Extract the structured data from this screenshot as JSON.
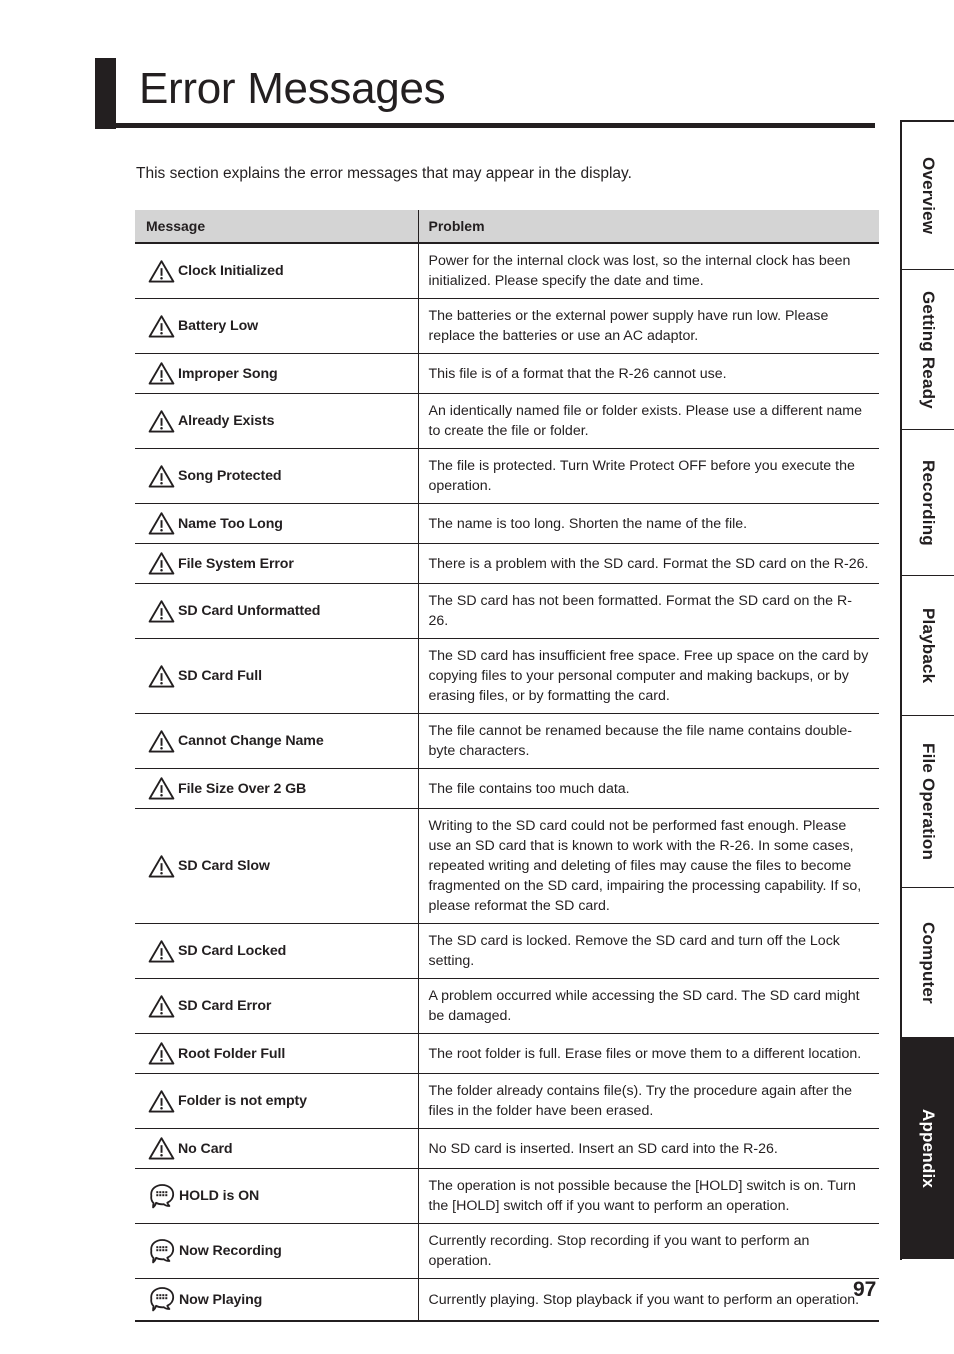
{
  "page": {
    "title": "Error Messages",
    "intro": "This section explains the error messages that may appear in the display.",
    "page_number": "97"
  },
  "table": {
    "headers": {
      "message": "Message",
      "problem": "Problem"
    },
    "rows": [
      {
        "icon": "warning-triangle-icon",
        "message": "Clock Initialized",
        "problem": "Power for the internal clock was lost, so the internal clock has been initialized. Please specify the date and time."
      },
      {
        "icon": "warning-triangle-icon",
        "message": "Battery Low",
        "problem": "The batteries or the external power supply have run low. Please replace the batteries or use an AC adaptor."
      },
      {
        "icon": "warning-triangle-icon",
        "message": "Improper Song",
        "problem": "This file is of a format that the R-26 cannot use."
      },
      {
        "icon": "warning-triangle-icon",
        "message": "Already Exists",
        "problem": "An identically named file or folder exists. Please use a different name to create the file or folder."
      },
      {
        "icon": "warning-triangle-icon",
        "message": "Song Protected",
        "problem": "The file is protected. Turn Write Protect OFF before you execute the operation."
      },
      {
        "icon": "warning-triangle-icon",
        "message": "Name Too Long",
        "problem": "The name is too long. Shorten the name of the file."
      },
      {
        "icon": "warning-triangle-icon",
        "message": "File System Error",
        "problem": "There is a problem with the SD card. Format the SD card on the R-26."
      },
      {
        "icon": "warning-triangle-icon",
        "message": "SD Card Unformatted",
        "problem": "The SD card has not been formatted. Format the SD card on the R-26."
      },
      {
        "icon": "warning-triangle-icon",
        "message": "SD Card Full",
        "problem": "The SD card has insufficient free space. Free up space on the card by copying files to your personal computer and making backups, or by erasing files, or by formatting the card."
      },
      {
        "icon": "warning-triangle-icon",
        "message": "Cannot Change Name",
        "problem": "The file cannot be renamed because the file name contains double-byte characters."
      },
      {
        "icon": "warning-triangle-icon",
        "message": "File Size Over 2 GB",
        "problem": "The file contains too much data."
      },
      {
        "icon": "warning-triangle-icon",
        "message": "SD Card Slow",
        "problem": "Writing to the SD card could not be performed fast enough. Please use an SD card that is known to work with the R-26. In some cases, repeated writing and deleting of files may cause the files to become fragmented on the SD card, impairing the processing capability. If so, please reformat the SD card."
      },
      {
        "icon": "warning-triangle-icon",
        "message": "SD Card Locked",
        "problem": "The SD card is locked. Remove the SD card and turn off the Lock setting."
      },
      {
        "icon": "warning-triangle-icon",
        "message": "SD Card Error",
        "problem": "A problem occurred while accessing the SD card. The SD card might be damaged."
      },
      {
        "icon": "warning-triangle-icon",
        "message": "Root Folder Full",
        "problem": "The root folder is full. Erase files or move them to a different location."
      },
      {
        "icon": "warning-triangle-icon",
        "message": "Folder is not empty",
        "problem": "The folder already contains file(s). Try the procedure again after the files in the folder have been erased."
      },
      {
        "icon": "warning-triangle-icon",
        "message": "No Card",
        "problem": "No SD card is inserted. Insert an SD card into the R-26."
      },
      {
        "icon": "message-bubble-icon",
        "message": "HOLD is ON",
        "problem": "The operation is not possible because the [HOLD] switch is on. Turn the [HOLD] switch off if you want to perform an operation."
      },
      {
        "icon": "message-bubble-icon",
        "message": "Now Recording",
        "problem": "Currently recording. Stop recording if you want to perform an operation."
      },
      {
        "icon": "message-bubble-icon",
        "message": "Now Playing",
        "problem": "Currently playing. Stop playback if you want to perform an operation."
      }
    ]
  },
  "side_tabs": {
    "items": [
      {
        "label": "Overview",
        "active": false
      },
      {
        "label": "Getting Ready",
        "active": false
      },
      {
        "label": "Recording",
        "active": false
      },
      {
        "label": "Playback",
        "active": false
      },
      {
        "label": "File Operation",
        "active": false
      },
      {
        "label": "Computer",
        "active": false
      },
      {
        "label": "Appendix",
        "active": true
      }
    ]
  },
  "colors": {
    "ink": "#231f20",
    "header_fill": "#d4d4d4",
    "paper": "#ffffff"
  }
}
